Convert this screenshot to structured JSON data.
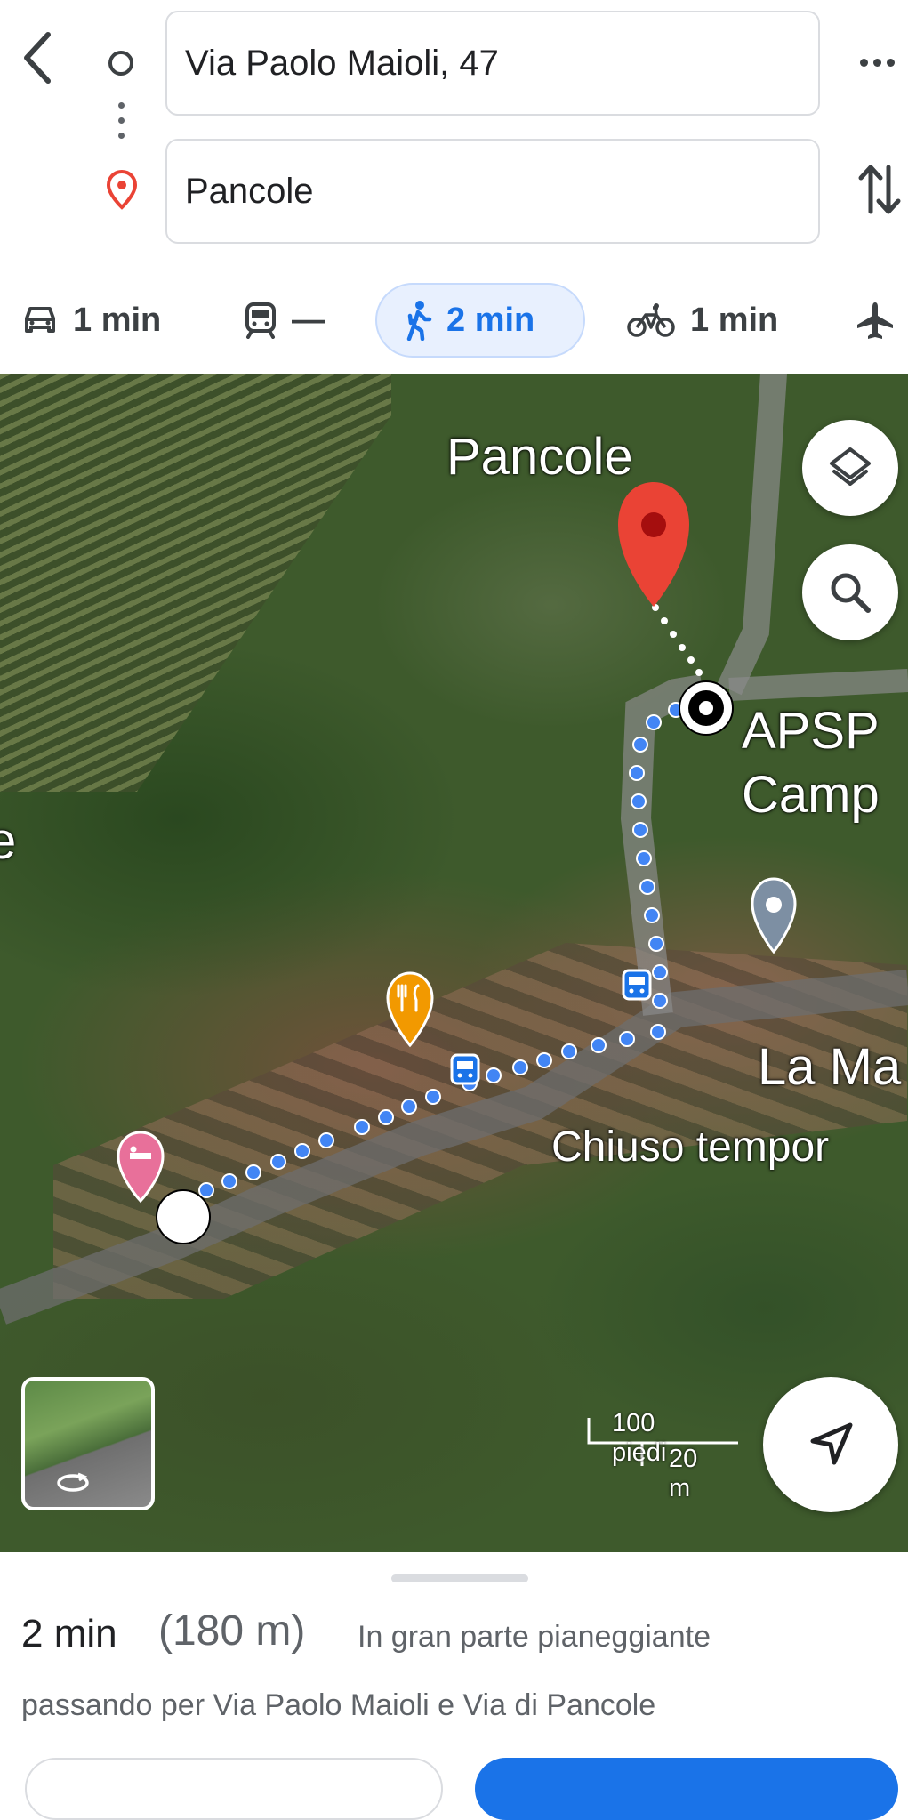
{
  "directions": {
    "origin": "Via Paolo Maioli, 47",
    "destination": "Pancole",
    "icons": {
      "back": "back-arrow-icon",
      "origin": "origin-circle-icon",
      "destination": "destination-pin-icon",
      "more": "more-options-icon",
      "swap": "swap-icon"
    }
  },
  "modes": [
    {
      "name": "car",
      "icon": "car-icon",
      "label": "1 min",
      "active": false
    },
    {
      "name": "transit",
      "icon": "train-icon",
      "label": "—",
      "active": false
    },
    {
      "name": "walk",
      "icon": "walk-icon",
      "label": "2 min",
      "active": true
    },
    {
      "name": "bike",
      "icon": "bike-icon",
      "label": "1 min",
      "active": false
    },
    {
      "name": "flight",
      "icon": "flight-icon",
      "label": "",
      "active": false
    }
  ],
  "map": {
    "labels": {
      "pancole": "Pancole",
      "apsp": "APSP",
      "camp": "Camp",
      "la_ma": "La Ma",
      "chiuso": "Chiuso tempor",
      "left_cut": "e"
    },
    "scale": {
      "imperial": "100 piedi",
      "metric": "20 m"
    },
    "icons": [
      "layers-icon",
      "search-icon",
      "my-location-icon",
      "street-view-icon",
      "restaurant-pin-icon",
      "hotel-pin-icon",
      "bus-stop-icon",
      "place-pin-icon"
    ]
  },
  "summary": {
    "time": "2 min",
    "distance": "(180 m)",
    "terrain": "In gran parte pianeggiante",
    "via": "passando per Via Paolo Maioli e Via di Pancole"
  },
  "colors": {
    "accent": "#1a73e8",
    "route": "#4285f4",
    "destination_pin": "#ea4335",
    "restaurant_pin": "#f29900",
    "hotel_pin": "#e8709a"
  }
}
